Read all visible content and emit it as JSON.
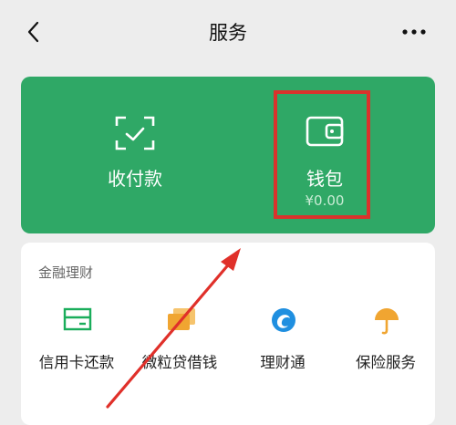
{
  "header": {
    "title": "服务",
    "back_icon": "chevron-left-icon",
    "more_icon": "ellipsis-icon"
  },
  "pay_card": {
    "background_color": "#2fa866",
    "items": [
      {
        "label": "收付款",
        "icon": "scan-qr-icon"
      },
      {
        "label": "钱包",
        "amount": "¥0.00",
        "icon": "wallet-icon"
      }
    ]
  },
  "annotation": {
    "highlight_color": "#d9332c",
    "highlight_target": "钱包"
  },
  "finance": {
    "section_title": "金融理财",
    "items": [
      {
        "label": "信用卡还款",
        "icon": "credit-card-icon",
        "color": "#1aad5b"
      },
      {
        "label": "微粒贷借钱",
        "icon": "cards-icon",
        "color": "#f0a531"
      },
      {
        "label": "理财通",
        "icon": "licaitong-icon",
        "color": "#1f8fe0"
      },
      {
        "label": "保险服务",
        "icon": "umbrella-icon",
        "color": "#f0a531"
      }
    ]
  }
}
